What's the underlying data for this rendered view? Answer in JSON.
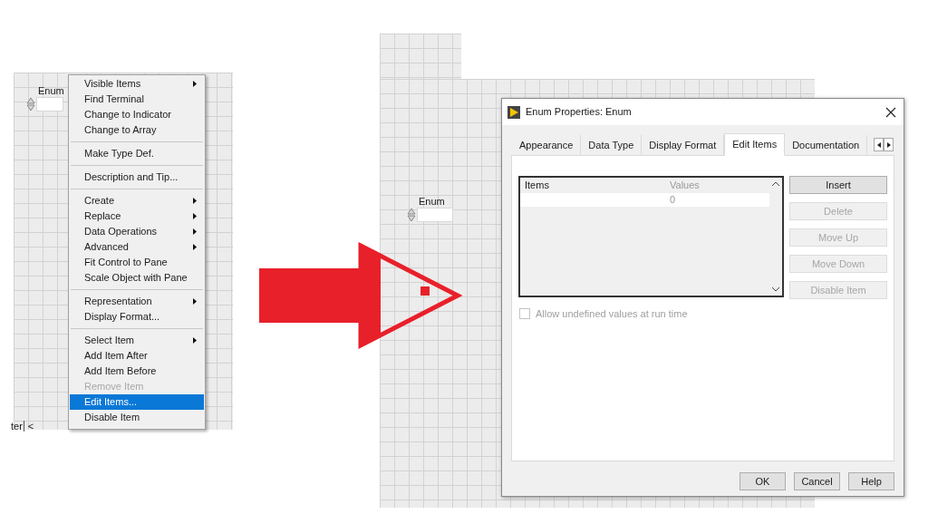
{
  "left_panel": {
    "enum_label": "Enum",
    "context_menu": {
      "groups": [
        [
          {
            "label": "Visible Items",
            "submenu": true,
            "disabled": false,
            "selected": false
          },
          {
            "label": "Find Terminal",
            "submenu": false,
            "disabled": false,
            "selected": false
          },
          {
            "label": "Change to Indicator",
            "submenu": false,
            "disabled": false,
            "selected": false
          },
          {
            "label": "Change to Array",
            "submenu": false,
            "disabled": false,
            "selected": false
          }
        ],
        [
          {
            "label": "Make Type Def.",
            "submenu": false,
            "disabled": false,
            "selected": false
          }
        ],
        [
          {
            "label": "Description and Tip...",
            "submenu": false,
            "disabled": false,
            "selected": false
          }
        ],
        [
          {
            "label": "Create",
            "submenu": true,
            "disabled": false,
            "selected": false
          },
          {
            "label": "Replace",
            "submenu": true,
            "disabled": false,
            "selected": false
          },
          {
            "label": "Data Operations",
            "submenu": true,
            "disabled": false,
            "selected": false
          },
          {
            "label": "Advanced",
            "submenu": true,
            "disabled": false,
            "selected": false
          },
          {
            "label": "Fit Control to Pane",
            "submenu": false,
            "disabled": false,
            "selected": false
          },
          {
            "label": "Scale Object with Pane",
            "submenu": false,
            "disabled": false,
            "selected": false
          }
        ],
        [
          {
            "label": "Representation",
            "submenu": true,
            "disabled": false,
            "selected": false
          },
          {
            "label": "Display Format...",
            "submenu": false,
            "disabled": false,
            "selected": false
          }
        ],
        [
          {
            "label": "Select Item",
            "submenu": true,
            "disabled": false,
            "selected": false
          },
          {
            "label": "Add Item After",
            "submenu": false,
            "disabled": false,
            "selected": false
          },
          {
            "label": "Add Item Before",
            "submenu": false,
            "disabled": false,
            "selected": false
          },
          {
            "label": "Remove Item",
            "submenu": false,
            "disabled": true,
            "selected": false
          },
          {
            "label": "Edit Items...",
            "submenu": false,
            "disabled": false,
            "selected": true
          },
          {
            "label": "Disable Item",
            "submenu": false,
            "disabled": false,
            "selected": false
          }
        ]
      ]
    },
    "bottom_fragment": {
      "text": "ter",
      "symbol": "<"
    }
  },
  "right_panel": {
    "enum_label": "Enum",
    "dialog": {
      "title": "Enum Properties: Enum",
      "tabs": [
        {
          "label": "Appearance",
          "selected": false
        },
        {
          "label": "Data Type",
          "selected": false
        },
        {
          "label": "Display Format",
          "selected": false
        },
        {
          "label": "Edit Items",
          "selected": true
        },
        {
          "label": "Documentation",
          "selected": false
        }
      ],
      "table": {
        "columns": [
          "Items",
          "Values"
        ],
        "rows": [
          {
            "value": "0"
          }
        ]
      },
      "side_buttons": [
        {
          "label": "Insert",
          "disabled": false
        },
        {
          "label": "Delete",
          "disabled": true
        },
        {
          "label": "Move Up",
          "disabled": true
        },
        {
          "label": "Move Down",
          "disabled": true
        },
        {
          "label": "Disable Item",
          "disabled": true
        }
      ],
      "checkbox": {
        "label": "Allow undefined values at run time",
        "checked": false,
        "disabled": true
      },
      "footer_buttons": [
        "OK",
        "Cancel",
        "Help"
      ]
    }
  }
}
